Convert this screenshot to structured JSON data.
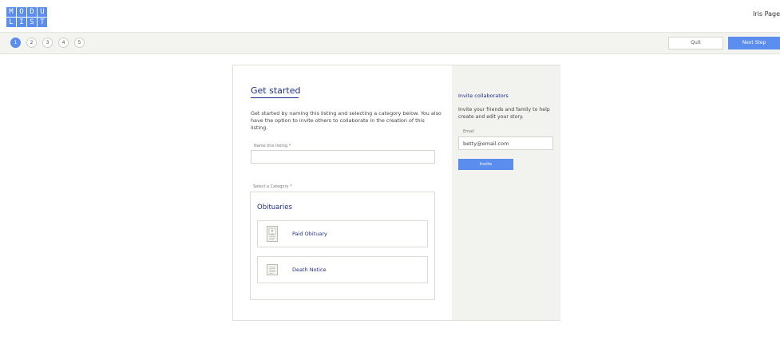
{
  "header": {
    "logo_letters": [
      "M",
      "O",
      "D",
      "U",
      "L",
      "I",
      "S",
      "T"
    ],
    "user_name": "Iris Page"
  },
  "stepbar": {
    "steps": [
      "1",
      "2",
      "3",
      "4",
      "5"
    ],
    "active_step": 1,
    "quit_label": "Quit",
    "next_label": "Next Step"
  },
  "main": {
    "title": "Get started",
    "intro": "Get started by naming this listing and selecting a category below. You also have the option to invite others to collaborate in the creation of this listing.",
    "name_label": "Name this listing *",
    "name_value": "",
    "category_label": "Select a Category *",
    "category_heading": "Obituaries",
    "options": [
      {
        "label": "Paid Obituary",
        "icon": "portrait-document-icon"
      },
      {
        "label": "Death Notice",
        "icon": "text-document-icon"
      }
    ]
  },
  "invite": {
    "title": "Invite collaborators",
    "description": "Invite your friends and family to help create and edit your story.",
    "email_label": "Email",
    "email_value": "betty@email.com",
    "button_label": "Invite"
  },
  "colors": {
    "accent": "#5b8def",
    "heading": "#1d2d8a",
    "panel_bg": "#f2f2ee"
  }
}
